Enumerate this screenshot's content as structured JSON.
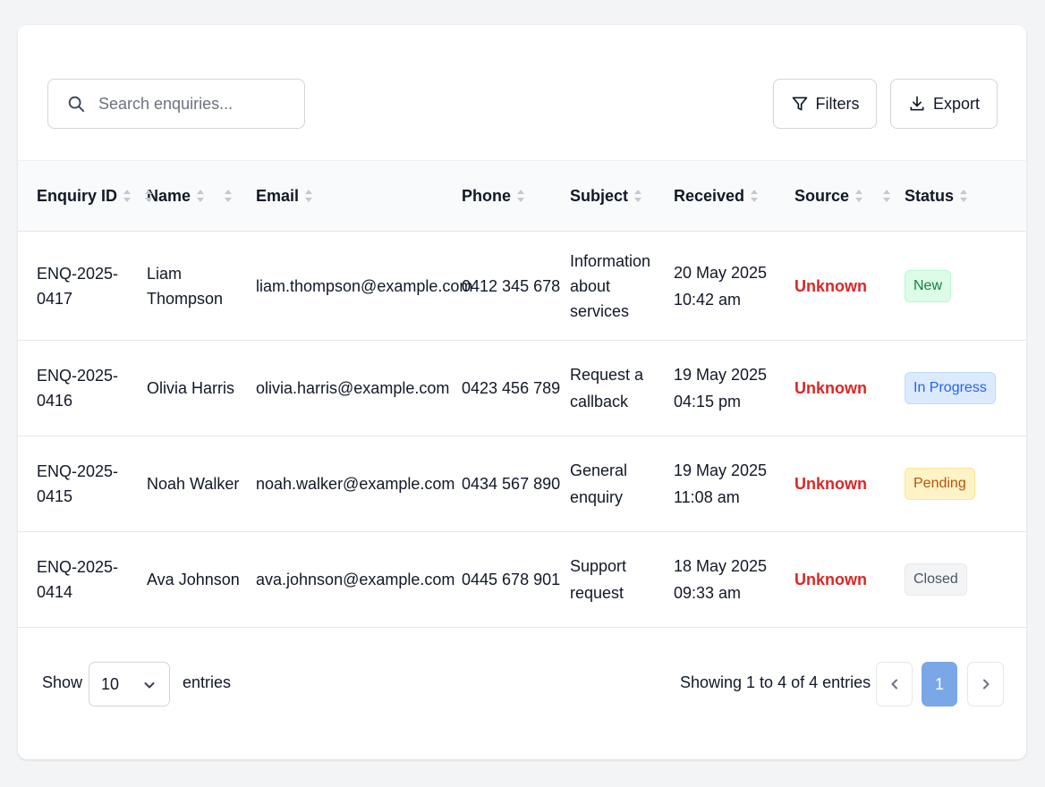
{
  "search": {
    "placeholder": "Search enquiries..."
  },
  "toolbar": {
    "filters_label": "Filters",
    "export_label": "Export"
  },
  "table": {
    "headers": [
      "Enquiry ID",
      "Name",
      "Email",
      "Phone",
      "Subject",
      "Received",
      "Source",
      "Status"
    ],
    "rows": [
      {
        "id": "ENQ-2025-0417",
        "name": "Liam Thompson",
        "email": "liam.thompson@example.com",
        "phone": "0412 345 678",
        "subject": [
          "Information",
          "about",
          "services"
        ],
        "received": [
          "20 May 2025",
          "10:42 am"
        ],
        "source": "Unknown",
        "status": "New"
      },
      {
        "id": "ENQ-2025-0416",
        "name": "Olivia Harris",
        "email": "olivia.harris@example.com",
        "phone": "0423 456 789",
        "subject": [
          "Request a",
          "callback"
        ],
        "received": [
          "19 May 2025",
          "04:15 pm"
        ],
        "source": "Unknown",
        "status": "In Progress"
      },
      {
        "id": "ENQ-2025-0415",
        "name": "Noah Walker",
        "email": "noah.walker@example.com",
        "phone": "0434 567 890",
        "subject": [
          "General",
          "enquiry"
        ],
        "received": [
          "19 May 2025",
          "11:08 am"
        ],
        "source": "Unknown",
        "status": "Pending"
      },
      {
        "id": "ENQ-2025-0414",
        "name": "Ava Johnson",
        "email": "ava.johnson@example.com",
        "phone": "0445 678 901",
        "subject": [
          "Support",
          "request"
        ],
        "received": [
          "18 May 2025",
          "09:33 am"
        ],
        "source": "Unknown",
        "status": "Closed"
      }
    ]
  },
  "footer": {
    "show_label": "Show",
    "page_size": "10",
    "entries_label": "entries",
    "showing_text": "Showing 1 to 4 of 4 entries",
    "current_page": "1"
  },
  "colors": {
    "source_text": "#dc2626",
    "status_new": "#15803d",
    "status_in_progress": "#2563eb",
    "status_pending": "#b45309",
    "status_closed": "#4b5563",
    "pagination_active": "#7aa7e8"
  },
  "icons": {
    "search": "search-icon",
    "filters": "filter-icon",
    "export": "download-icon",
    "select": "chevron-down-icon",
    "prev": "chevron-left-icon",
    "next": "chevron-right-icon",
    "sort": "sort-icon"
  }
}
